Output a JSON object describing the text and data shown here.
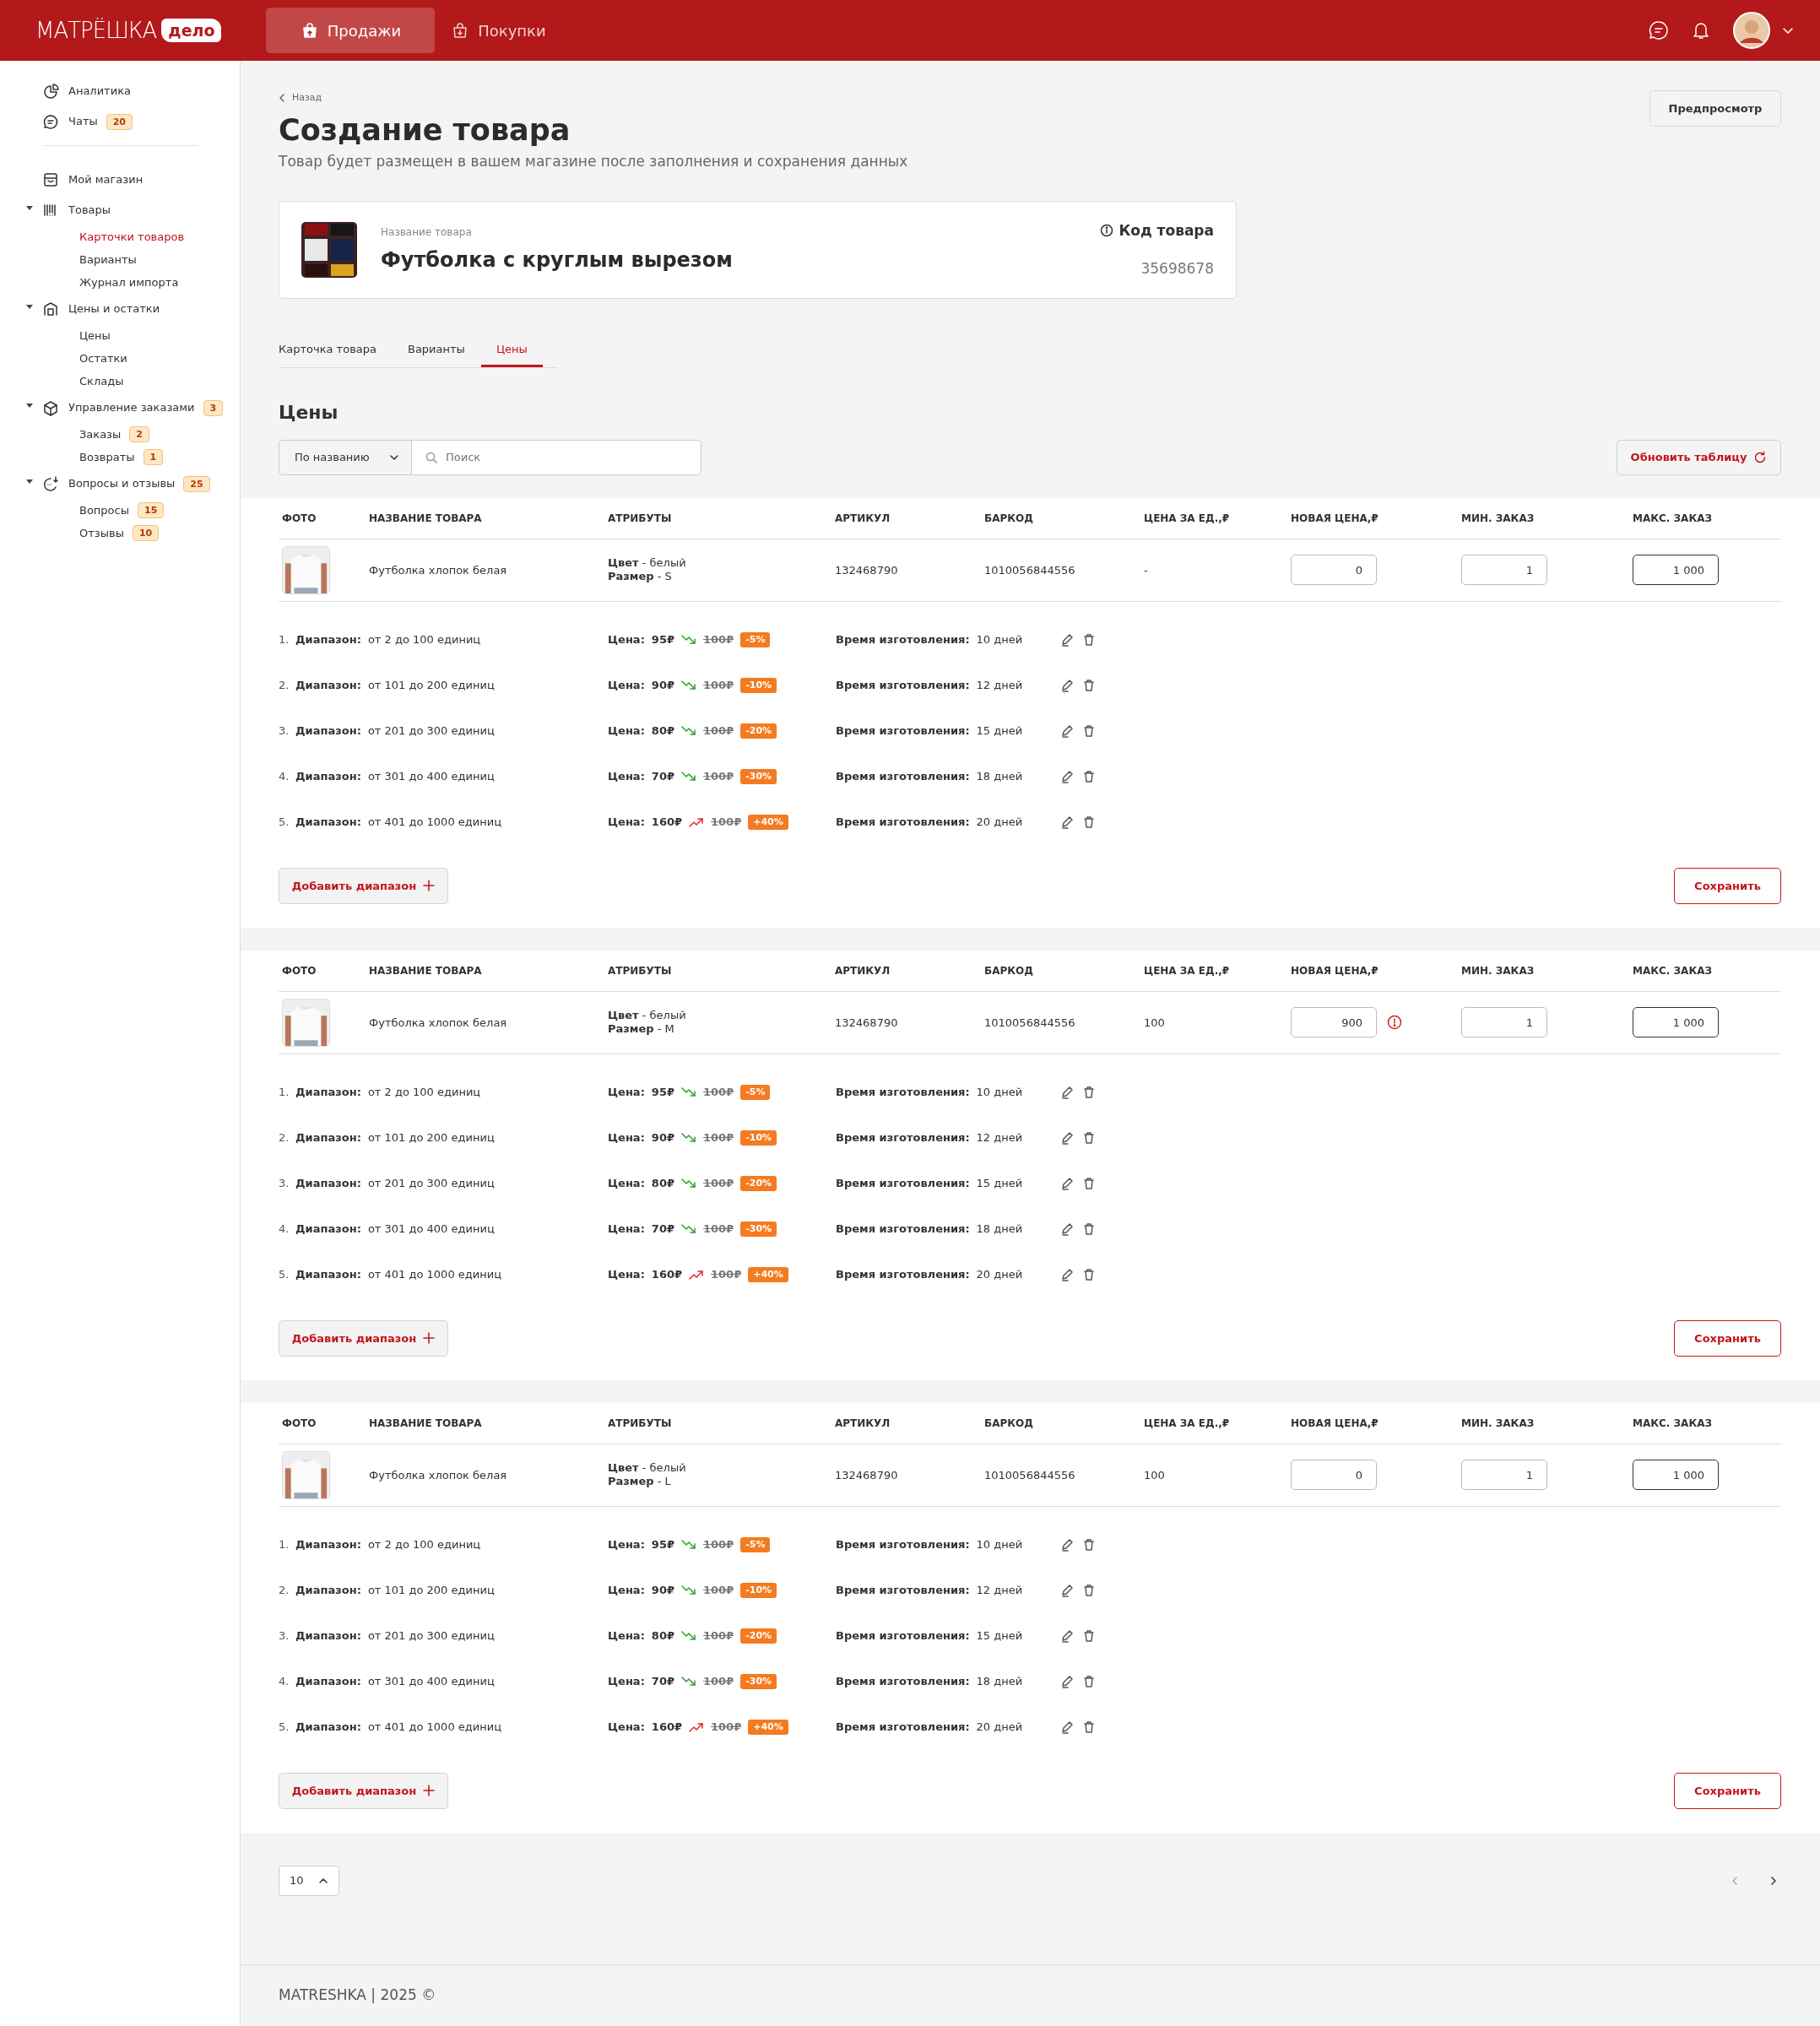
{
  "header": {
    "logo": "МАТРЁШКА",
    "logo_badge": "дело",
    "nav": [
      {
        "label": "Продажи",
        "selected": true
      },
      {
        "label": "Покупки",
        "selected": false
      }
    ]
  },
  "sidebar": {
    "groups": [
      {
        "items": [
          {
            "label": "Аналитика",
            "selected": false
          },
          {
            "label": "Чаты",
            "badge": "20",
            "selected": false
          }
        ]
      },
      {
        "items": [
          {
            "label": "Мой магазин",
            "selected": false
          },
          {
            "label": "Товары",
            "selected": false,
            "expanded": true,
            "children": [
              {
                "label": "Карточки товаров",
                "selected": true
              },
              {
                "label": "Варианты",
                "selected": false
              },
              {
                "label": "Журнал импорта",
                "selected": false
              }
            ]
          },
          {
            "label": "Цены и остатки",
            "selected": false,
            "expanded": true,
            "children": [
              {
                "label": "Цены",
                "selected": false
              },
              {
                "label": "Остатки",
                "selected": false
              },
              {
                "label": "Склады",
                "selected": false
              }
            ]
          },
          {
            "label": "Управление заказами",
            "badge": "3",
            "selected": false,
            "expanded": true,
            "children": [
              {
                "label": "Заказы",
                "badge": "2",
                "selected": false
              },
              {
                "label": "Возвраты",
                "badge": "1",
                "selected": false
              }
            ]
          },
          {
            "label": "Вопросы и отзывы",
            "badge": "25",
            "selected": false,
            "expanded": true,
            "children": [
              {
                "label": "Вопросы",
                "badge": "15",
                "selected": false
              },
              {
                "label": "Отзывы",
                "badge": "10",
                "selected": false
              }
            ]
          }
        ]
      }
    ]
  },
  "breadcrumb": "Назад",
  "preview_button": "Предпросмотр",
  "title": "Создание товара",
  "subtitle": "Товар будет размещен в вашем магазине после заполнения и сохранения данных",
  "product_card": {
    "name_label": "Название товара",
    "name": "Футболка с круглым вырезом",
    "code_label": "Код товара",
    "code": "35698678"
  },
  "tabs": [
    {
      "label": "Карточка товара",
      "selected": false
    },
    {
      "label": "Варианты",
      "selected": false
    },
    {
      "label": "Цены",
      "selected": true
    }
  ],
  "section_title": "Цены",
  "filter": {
    "dropdown": "По названию",
    "search_placeholder": "Поиск"
  },
  "refresh_button": "Обновить таблицу",
  "blocks": [
    {
      "columns": [
        "ФОТО",
        "НАЗВАНИЕ ТОВАРА",
        "АТРИБУТЫ",
        "АРТИКУЛ",
        "БАРКОД",
        "ЦЕНА ЗА ЕД.,₽",
        "НОВАЯ ЦЕНА,₽",
        "МИН. ЗАКАЗ",
        "МАКС. ЗАКАЗ"
      ],
      "row": {
        "name": "Футболка хлопок белая",
        "attributes": [
          "**Цвет** - белый",
          "**Размер** - S"
        ],
        "article": "132468790",
        "barcode": "1010056844556",
        "unit_price": "-",
        "new_price": {
          "value": "0",
          "focused": false,
          "warning": false
        },
        "min_order": {
          "value": "1",
          "focused": false
        },
        "max_order": {
          "value": "1 000",
          "focused": true
        }
      },
      "ranges": [
        {
          "num": "1.",
          "label": "Диапазон:",
          "value": "от 2 до 100 единиц",
          "price_label": "Цена:",
          "price": "95₽",
          "increase": false,
          "old_price": "100₽",
          "discount": "-5%",
          "time_label": "Время изготовления:",
          "time": "10 дней"
        },
        {
          "num": "2.",
          "label": "Диапазон:",
          "value": "от 101 до 200 единиц",
          "price_label": "Цена:",
          "price": "90₽",
          "increase": false,
          "old_price": "100₽",
          "discount": "-10%",
          "time_label": "Время изготовления:",
          "time": "12 дней"
        },
        {
          "num": "3.",
          "label": "Диапазон:",
          "value": "от 201 до 300 единиц",
          "price_label": "Цена:",
          "price": "80₽",
          "increase": false,
          "old_price": "100₽",
          "discount": "-20%",
          "time_label": "Время изготовления:",
          "time": "15 дней"
        },
        {
          "num": "4.",
          "label": "Диапазон:",
          "value": "от 301 до 400 единиц",
          "price_label": "Цена:",
          "price": "70₽",
          "increase": false,
          "old_price": "100₽",
          "discount": "-30%",
          "time_label": "Время изготовления:",
          "time": "18 дней"
        },
        {
          "num": "5.",
          "label": "Диапазон:",
          "value": "от 401 до 1000 единиц",
          "price_label": "Цена:",
          "price": "160₽",
          "increase": true,
          "old_price": "100₽",
          "discount": "+40%",
          "time_label": "Время изготовления:",
          "time": "20 дней"
        }
      ],
      "add_button": "Добавить диапазон",
      "save_button": "Сохранить"
    },
    {
      "columns": [
        "ФОТО",
        "НАЗВАНИЕ ТОВАРА",
        "АТРИБУТЫ",
        "АРТИКУЛ",
        "БАРКОД",
        "ЦЕНА ЗА ЕД.,₽",
        "НОВАЯ ЦЕНА,₽",
        "МИН. ЗАКАЗ",
        "МАКС. ЗАКАЗ"
      ],
      "row": {
        "name": "Футболка хлопок белая",
        "attributes": [
          "**Цвет** - белый",
          "**Размер** - M"
        ],
        "article": "132468790",
        "barcode": "1010056844556",
        "unit_price": "100",
        "new_price": {
          "value": "900",
          "focused": false,
          "warning": true
        },
        "min_order": {
          "value": "1",
          "focused": false
        },
        "max_order": {
          "value": "1 000",
          "focused": true
        }
      },
      "ranges": [
        {
          "num": "1.",
          "label": "Диапазон:",
          "value": "от 2 до 100 единиц",
          "price_label": "Цена:",
          "price": "95₽",
          "increase": false,
          "old_price": "100₽",
          "discount": "-5%",
          "time_label": "Время изготовления:",
          "time": "10 дней"
        },
        {
          "num": "2.",
          "label": "Диапазон:",
          "value": "от 101 до 200 единиц",
          "price_label": "Цена:",
          "price": "90₽",
          "increase": false,
          "old_price": "100₽",
          "discount": "-10%",
          "time_label": "Время изготовления:",
          "time": "12 дней"
        },
        {
          "num": "3.",
          "label": "Диапазон:",
          "value": "от 201 до 300 единиц",
          "price_label": "Цена:",
          "price": "80₽",
          "increase": false,
          "old_price": "100₽",
          "discount": "-20%",
          "time_label": "Время изготовления:",
          "time": "15 дней"
        },
        {
          "num": "4.",
          "label": "Диапазон:",
          "value": "от 301 до 400 единиц",
          "price_label": "Цена:",
          "price": "70₽",
          "increase": false,
          "old_price": "100₽",
          "discount": "-30%",
          "time_label": "Время изготовления:",
          "time": "18 дней"
        },
        {
          "num": "5.",
          "label": "Диапазон:",
          "value": "от 401 до 1000 единиц",
          "price_label": "Цена:",
          "price": "160₽",
          "increase": true,
          "old_price": "100₽",
          "discount": "+40%",
          "time_label": "Время изготовления:",
          "time": "20 дней"
        }
      ],
      "add_button": "Добавить диапазон",
      "save_button": "Сохранить"
    },
    {
      "columns": [
        "ФОТО",
        "НАЗВАНИЕ ТОВАРА",
        "АТРИБУТЫ",
        "АРТИКУЛ",
        "БАРКОД",
        "ЦЕНА ЗА ЕД.,₽",
        "НОВАЯ ЦЕНА,₽",
        "МИН. ЗАКАЗ",
        "МАКС. ЗАКАЗ"
      ],
      "row": {
        "name": "Футболка хлопок белая",
        "attributes": [
          "**Цвет** - белый",
          "**Размер** - L"
        ],
        "article": "132468790",
        "barcode": "1010056844556",
        "unit_price": "100",
        "new_price": {
          "value": "0",
          "focused": false,
          "warning": false
        },
        "min_order": {
          "value": "1",
          "focused": false
        },
        "max_order": {
          "value": "1 000",
          "focused": true
        }
      },
      "ranges": [
        {
          "num": "1.",
          "label": "Диапазон:",
          "value": "от 2 до 100 единиц",
          "price_label": "Цена:",
          "price": "95₽",
          "increase": false,
          "old_price": "100₽",
          "discount": "-5%",
          "time_label": "Время изготовления:",
          "time": "10 дней"
        },
        {
          "num": "2.",
          "label": "Диапазон:",
          "value": "от 101 до 200 единиц",
          "price_label": "Цена:",
          "price": "90₽",
          "increase": false,
          "old_price": "100₽",
          "discount": "-10%",
          "time_label": "Время изготовления:",
          "time": "12 дней"
        },
        {
          "num": "3.",
          "label": "Диапазон:",
          "value": "от 201 до 300 единиц",
          "price_label": "Цена:",
          "price": "80₽",
          "increase": false,
          "old_price": "100₽",
          "discount": "-20%",
          "time_label": "Время изготовления:",
          "time": "15 дней"
        },
        {
          "num": "4.",
          "label": "Диапазон:",
          "value": "от 301 до 400 единиц",
          "price_label": "Цена:",
          "price": "70₽",
          "increase": false,
          "old_price": "100₽",
          "discount": "-30%",
          "time_label": "Время изготовления:",
          "time": "18 дней"
        },
        {
          "num": "5.",
          "label": "Диапазон:",
          "value": "от 401 до 1000 единиц",
          "price_label": "Цена:",
          "price": "160₽",
          "increase": true,
          "old_price": "100₽",
          "discount": "+40%",
          "time_label": "Время изготовления:",
          "time": "20 дней"
        }
      ],
      "add_button": "Добавить диапазон",
      "save_button": "Сохранить"
    }
  ],
  "pagination": {
    "page_size": "10"
  },
  "footer": "MATRESHKA | 2025 ©"
}
